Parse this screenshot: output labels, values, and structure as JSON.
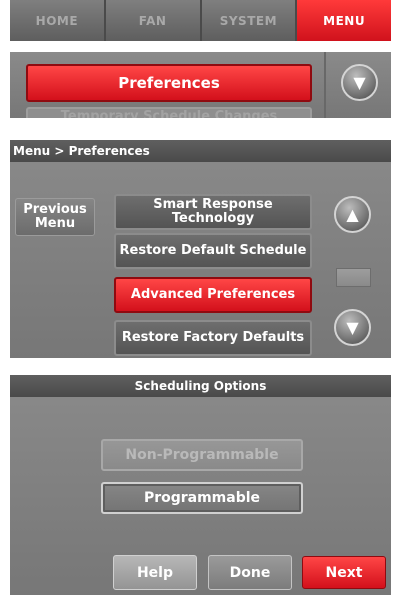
{
  "nav": {
    "tabs": [
      {
        "label": "HOME",
        "active": false
      },
      {
        "label": "FAN",
        "active": false
      },
      {
        "label": "SYSTEM",
        "active": false
      },
      {
        "label": "MENU",
        "active": true
      }
    ]
  },
  "menu_list": {
    "selected_item": "Preferences",
    "next_item": "Temporary Schedule Changes",
    "scroll_down_icon": "triangle-down-icon"
  },
  "preferences_menu": {
    "breadcrumb": "Menu > Preferences",
    "previous_menu_label": "Previous Menu",
    "items": [
      {
        "label": "Smart Response Technology"
      },
      {
        "label": "Restore Default Schedule"
      },
      {
        "label": "Advanced Preferences",
        "active": true
      },
      {
        "label": "Restore Factory Defaults"
      }
    ],
    "scroll_up_icon": "triangle-up-icon",
    "scroll_down_icon": "triangle-down-icon"
  },
  "scheduling": {
    "title": "Scheduling Options",
    "options": [
      {
        "label": "Non-Programmable",
        "state": "disabled"
      },
      {
        "label": "Programmable",
        "state": "selected"
      }
    ],
    "help_label": "Help",
    "done_label": "Done",
    "next_label": "Next"
  },
  "colors": {
    "accent_red": "#e8141f",
    "panel_gray": "#7d7d7d",
    "header_gray": "#525252"
  }
}
